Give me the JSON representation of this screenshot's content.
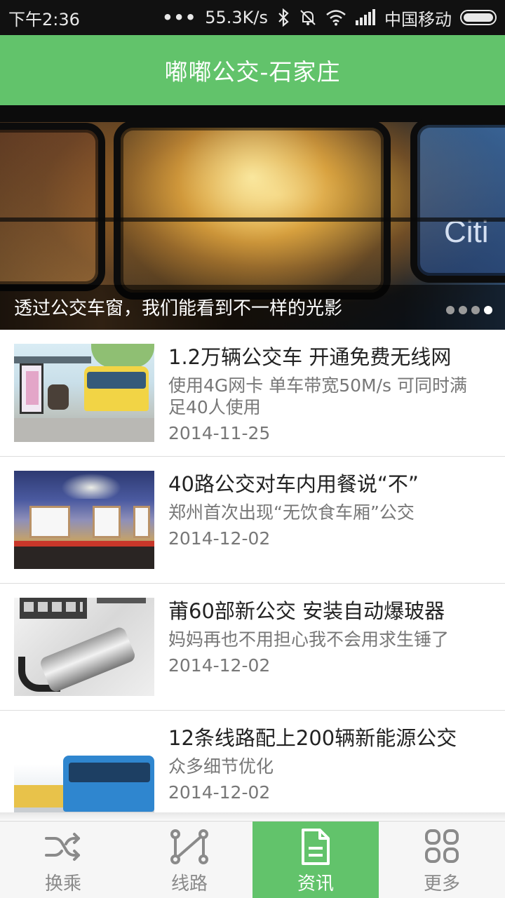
{
  "status_bar": {
    "time": "下午2:36",
    "network_speed": "55.3K/s",
    "carrier": "中国移动",
    "icons": [
      "more-dots-icon",
      "bluetooth-icon",
      "mute-bell-icon",
      "wifi-icon",
      "signal-icon",
      "battery-icon"
    ]
  },
  "app_bar": {
    "title": "嘟嘟公交-石家庄"
  },
  "banner": {
    "caption": "透过公交车窗，我们能看到不一样的光影",
    "window_sign": "Citi",
    "page_count": 4,
    "active_page": 4
  },
  "news": {
    "items": [
      {
        "title": "1.2万辆公交车 开通免费无线网",
        "desc": "使用4G网卡 单车带宽50M/s 可同时满足40人使用",
        "date": "2014-11-25"
      },
      {
        "title": "40路公交对车内用餐说“不”",
        "desc": "郑州首次出现“无饮食车厢”公交",
        "date": "2014-12-02"
      },
      {
        "title": "莆60部新公交 安装自动爆玻器",
        "desc": "妈妈再也不用担心我不会用求生锤了",
        "date": "2014-12-02"
      },
      {
        "title": "12条线路配上200辆新能源公交",
        "desc": "众多细节优化",
        "date": "2014-12-02"
      }
    ]
  },
  "bottom_nav": {
    "items": [
      {
        "label": "换乘",
        "icon": "shuffle-icon"
      },
      {
        "label": "线路",
        "icon": "route-icon"
      },
      {
        "label": "资讯",
        "icon": "document-icon"
      },
      {
        "label": "更多",
        "icon": "grid-icon"
      }
    ],
    "active_index": 2
  },
  "colors": {
    "primary_green": "#62c36b",
    "status_bar": "#111111",
    "nav_inactive": "#8a8a8a",
    "text_primary": "#222222",
    "text_secondary": "#777777"
  }
}
